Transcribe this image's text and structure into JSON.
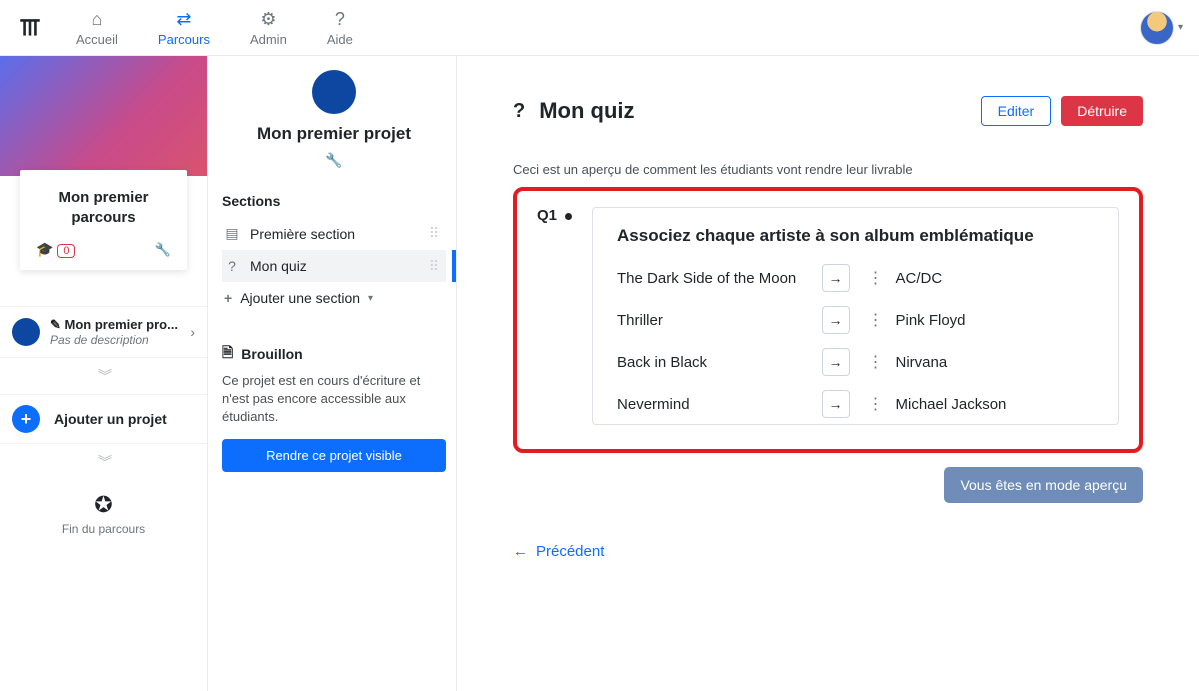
{
  "nav": {
    "accueil": "Accueil",
    "parcours": "Parcours",
    "admin": "Admin",
    "aide": "Aide"
  },
  "col1": {
    "parcours_title": "Mon premier parcours",
    "student_count": "0",
    "project_name": "Mon premier pro...",
    "project_desc": "Pas de description",
    "add_project": "Ajouter un projet",
    "fin": "Fin du parcours"
  },
  "col2": {
    "project_title": "Mon premier projet",
    "sections_heading": "Sections",
    "section1": "Première section",
    "section2": "Mon quiz",
    "add_section": "Ajouter une section",
    "brouillon_title": "Brouillon",
    "brouillon_desc": "Ce projet est en cours d'écriture et n'est pas encore accessible aux étudiants.",
    "btn_visible": "Rendre ce projet visible"
  },
  "col3": {
    "page_title": "Mon quiz",
    "btn_edit": "Editer",
    "btn_destroy": "Détruire",
    "preview_note": "Ceci est un aperçu de comment les étudiants vont rendre leur livrable",
    "q_label": "Q1",
    "q_title": "Associez chaque artiste à son album emblématique",
    "left": [
      "The Dark Side of the Moon",
      "Thriller",
      "Back in Black",
      "Nevermind"
    ],
    "right": [
      "AC/DC",
      "Pink Floyd",
      "Nirvana",
      "Michael Jackson"
    ],
    "preview_badge": "Vous êtes en mode aperçu",
    "prev_link": "Précédent"
  }
}
